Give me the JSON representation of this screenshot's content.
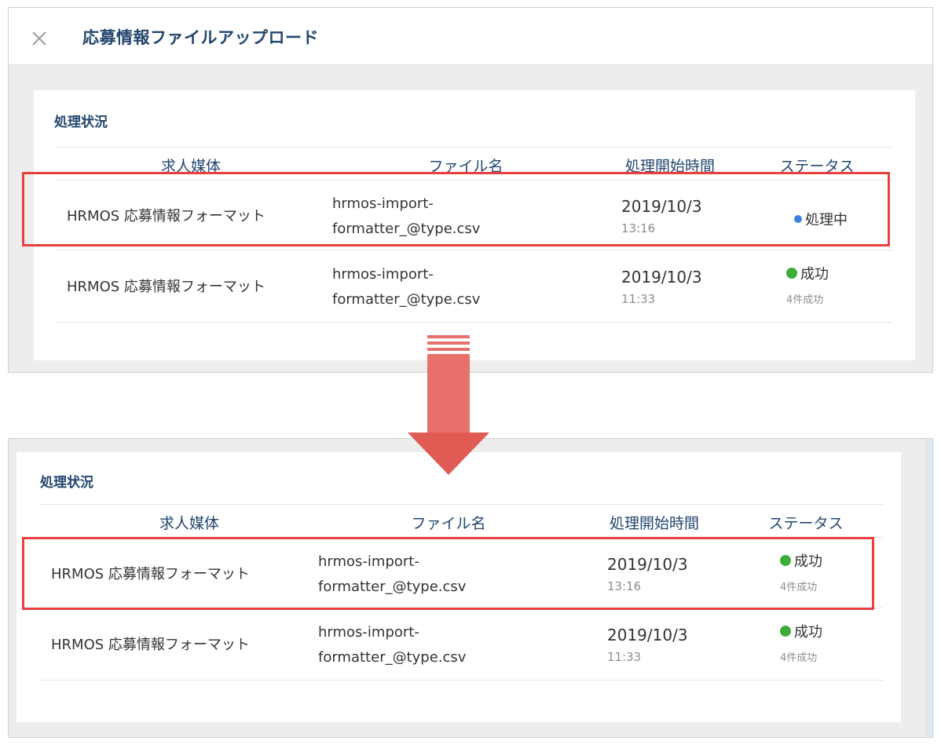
{
  "modal": {
    "title": "応募情報ファイルアップロード",
    "close_icon": "close-icon"
  },
  "before": {
    "section_title": "処理状況",
    "columns": [
      "求人媒体",
      "ファイル名",
      "処理開始時間",
      "ステータス"
    ],
    "rows": [
      {
        "medium": "HRMOS 応募情報フォーマット",
        "file_line1": "hrmos-import-",
        "file_line2": "formatter_@type.csv",
        "date": "2019/10/3",
        "time": "13:16",
        "status": "処理中",
        "status_color": "#3d82e0",
        "status_detail": ""
      },
      {
        "medium": "HRMOS 応募情報フォーマット",
        "file_line1": "hrmos-import-",
        "file_line2": "formatter_@type.csv",
        "date": "2019/10/3",
        "time": "11:33",
        "status": "成功",
        "status_color": "#3dac3b",
        "status_detail": "4件成功"
      }
    ]
  },
  "after": {
    "section_title": "処理状況",
    "columns": [
      "求人媒体",
      "ファイル名",
      "処理開始時間",
      "ステータス"
    ],
    "rows": [
      {
        "medium": "HRMOS 応募情報フォーマット",
        "file_line1": "hrmos-import-",
        "file_line2": "formatter_@type.csv",
        "date": "2019/10/3",
        "time": "13:16",
        "status": "成功",
        "status_color": "#3dac3b",
        "status_detail": "4件成功"
      },
      {
        "medium": "HRMOS 応募情報フォーマット",
        "file_line1": "hrmos-import-",
        "file_line2": "formatter_@type.csv",
        "date": "2019/10/3",
        "time": "11:33",
        "status": "成功",
        "status_color": "#3dac3b",
        "status_detail": "4件成功"
      }
    ]
  },
  "colors": {
    "highlight": "#e8403d",
    "arrow": "#e8706a",
    "title_text": "#23466e"
  }
}
